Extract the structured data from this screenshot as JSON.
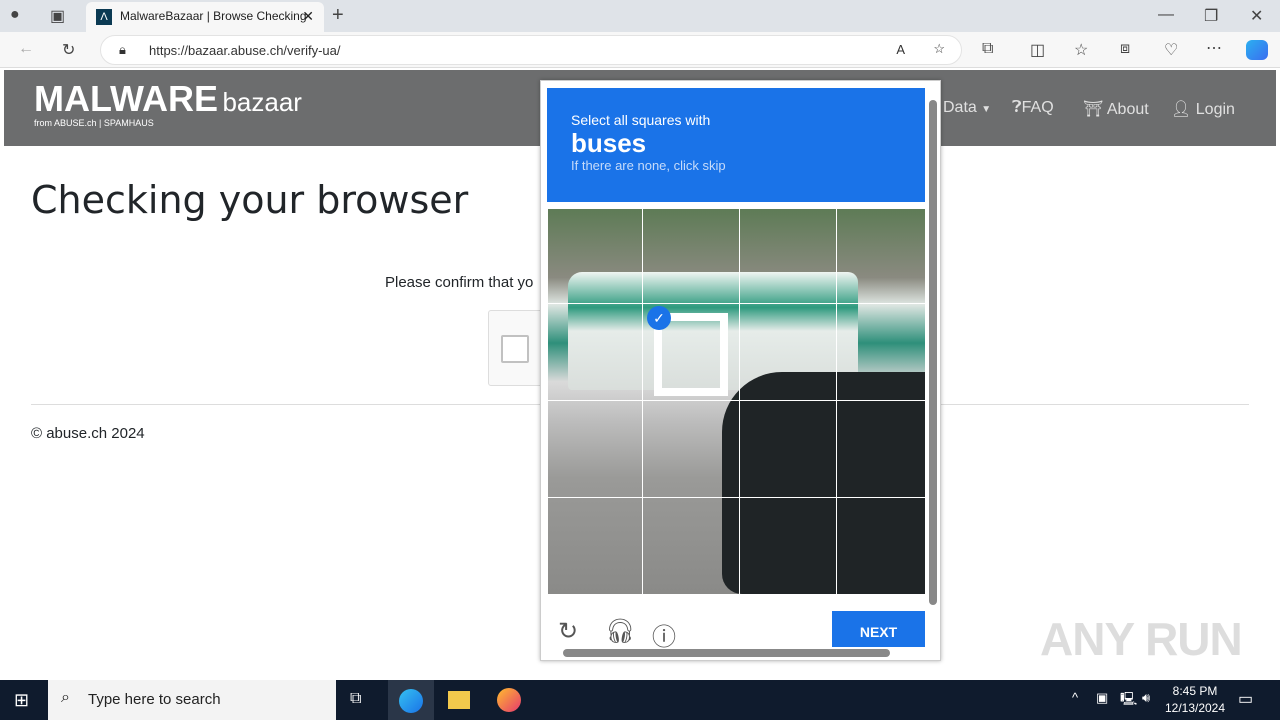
{
  "browser": {
    "tab_title": "MalwareBazaar | Browse Checking",
    "url": "https://bazaar.abuse.ch/verify-ua/"
  },
  "site": {
    "logo_main": "MALWARE",
    "logo_sub": "bazaar",
    "logo_from": "from ABUSE.ch | SPAMHAUS",
    "nav": [
      {
        "label": "Data",
        "icon": "caret-down-icon"
      },
      {
        "label": "FAQ",
        "icon": "question-circle-icon"
      },
      {
        "label": "About",
        "icon": "building-icon"
      },
      {
        "label": "Login",
        "icon": "user-icon"
      }
    ]
  },
  "main": {
    "title": "Checking your browser",
    "confirm_text": "Please confirm that yo",
    "footer": "© abuse.ch 2024"
  },
  "captcha": {
    "instruction": "Select all squares with",
    "target": "buses",
    "hint": "If there are none, click skip",
    "next_label": "NEXT",
    "selected_cells": [
      5
    ]
  },
  "taskbar": {
    "search_placeholder": "Type here to search",
    "time": "8:45 PM",
    "date": "12/13/2024"
  },
  "watermark": "ANY RUN",
  "colors": {
    "accent": "#1a73e8",
    "header": "#6c6d6e",
    "taskbar": "#0f1b2d"
  }
}
